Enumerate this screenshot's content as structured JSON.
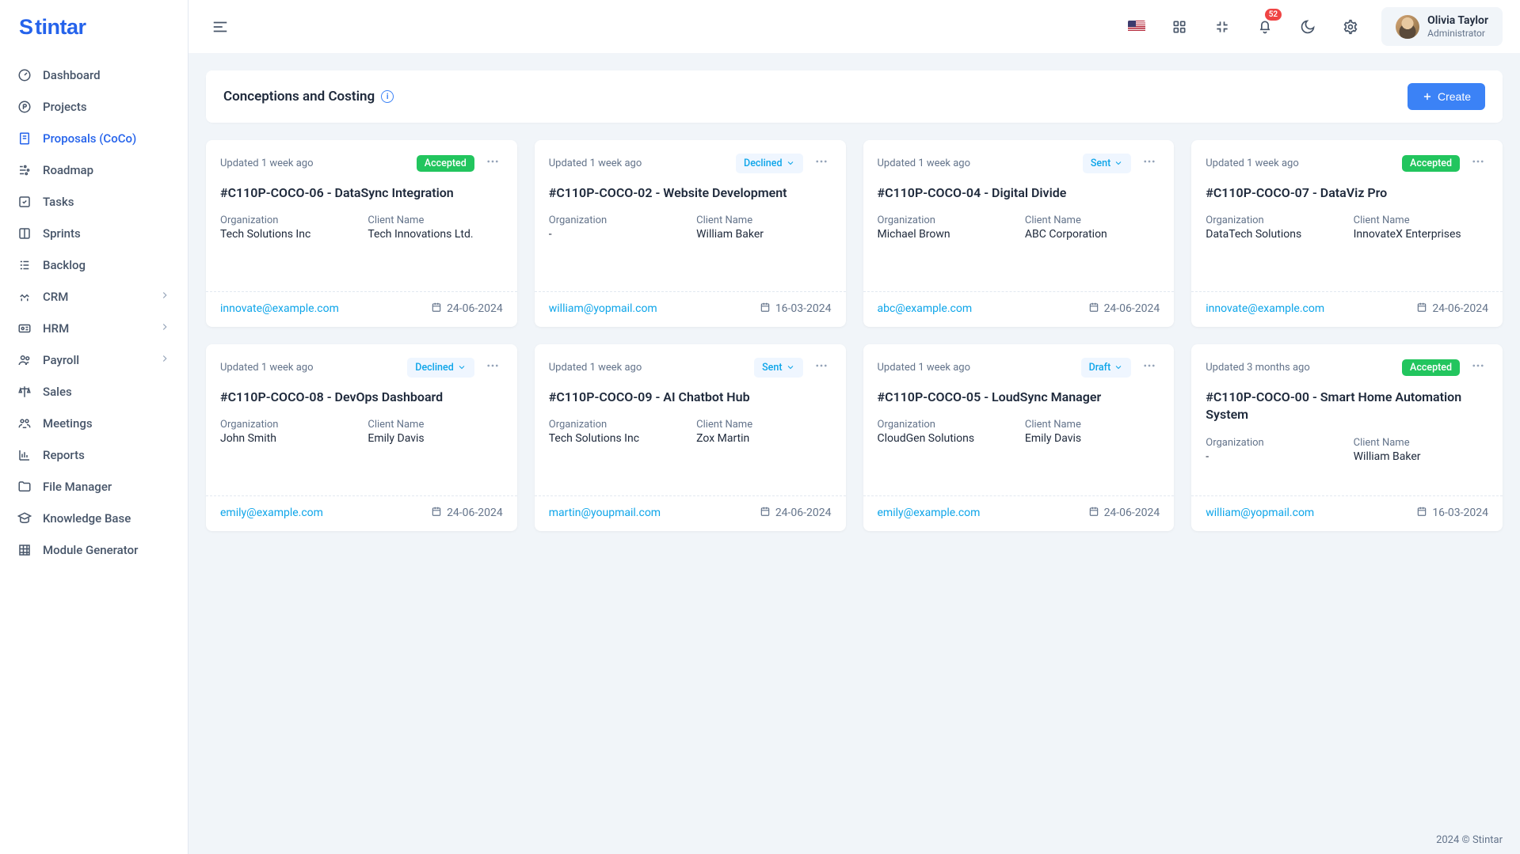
{
  "brand": "Stintar",
  "header": {
    "notification_count": "52",
    "user_name": "Olivia Taylor",
    "user_role": "Administrator"
  },
  "sidebar": {
    "items": [
      {
        "label": "Dashboard"
      },
      {
        "label": "Projects"
      },
      {
        "label": "Proposals (CoCo)"
      },
      {
        "label": "Roadmap"
      },
      {
        "label": "Tasks"
      },
      {
        "label": "Sprints"
      },
      {
        "label": "Backlog"
      },
      {
        "label": "CRM"
      },
      {
        "label": "HRM"
      },
      {
        "label": "Payroll"
      },
      {
        "label": "Sales"
      },
      {
        "label": "Meetings"
      },
      {
        "label": "Reports"
      },
      {
        "label": "File Manager"
      },
      {
        "label": "Knowledge Base"
      },
      {
        "label": "Module Generator"
      }
    ]
  },
  "page": {
    "title": "Conceptions and Costing",
    "create_label": "Create",
    "labels": {
      "organization": "Organization",
      "client_name": "Client Name"
    }
  },
  "cards": [
    {
      "updated": "Updated 1 week ago",
      "status": "Accepted",
      "status_type": "accepted",
      "title": "#C110P-COCO-06 - DataSync Integration",
      "org": "Tech Solutions Inc",
      "client": "Tech Innovations Ltd.",
      "email": "innovate@example.com",
      "date": "24-06-2024"
    },
    {
      "updated": "Updated 1 week ago",
      "status": "Declined",
      "status_type": "dropdown",
      "title": "#C110P-COCO-02 - Website Development",
      "org": "-",
      "client": "William Baker",
      "email": "william@yopmail.com",
      "date": "16-03-2024"
    },
    {
      "updated": "Updated 1 week ago",
      "status": "Sent",
      "status_type": "dropdown",
      "title": "#C110P-COCO-04 - Digital Divide",
      "org": "Michael Brown",
      "client": "ABC Corporation",
      "email": "abc@example.com",
      "date": "24-06-2024"
    },
    {
      "updated": "Updated 1 week ago",
      "status": "Accepted",
      "status_type": "accepted",
      "title": "#C110P-COCO-07 - DataViz Pro",
      "org": "DataTech Solutions",
      "client": "InnovateX Enterprises",
      "email": "innovate@example.com",
      "date": "24-06-2024"
    },
    {
      "updated": "Updated 1 week ago",
      "status": "Declined",
      "status_type": "dropdown",
      "title": "#C110P-COCO-08 - DevOps Dashboard",
      "org": "John Smith",
      "client": "Emily Davis",
      "email": "emily@example.com",
      "date": "24-06-2024"
    },
    {
      "updated": "Updated 1 week ago",
      "status": "Sent",
      "status_type": "dropdown",
      "title": "#C110P-COCO-09 - AI Chatbot Hub",
      "org": "Tech Solutions Inc",
      "client": "Zox Martin",
      "email": "martin@youpmail.com",
      "date": "24-06-2024"
    },
    {
      "updated": "Updated 1 week ago",
      "status": "Draft",
      "status_type": "dropdown",
      "title": "#C110P-COCO-05 - LoudSync Manager",
      "org": "CloudGen Solutions",
      "client": "Emily Davis",
      "email": "emily@example.com",
      "date": "24-06-2024"
    },
    {
      "updated": "Updated 3 months ago",
      "status": "Accepted",
      "status_type": "accepted",
      "title": "#C110P-COCO-00 - Smart Home Automation System",
      "org": "-",
      "client": "William Baker",
      "email": "william@yopmail.com",
      "date": "16-03-2024"
    }
  ],
  "footer": "2024 © Stintar"
}
